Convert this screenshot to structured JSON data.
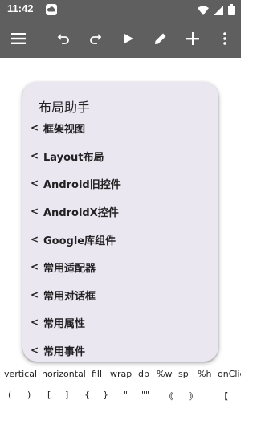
{
  "status_bar": {
    "time": "11:42",
    "icons": [
      "cloud-icon",
      "wifi-icon",
      "signal-icon",
      "battery-icon"
    ]
  },
  "toolbar": {
    "icons": [
      "menu-icon",
      "undo-icon",
      "redo-icon",
      "play-icon",
      "edit-icon",
      "add-icon",
      "more-vert-icon"
    ],
    "background": "#5f5f5f"
  },
  "card": {
    "title": "布局助手",
    "background": "#ebe7f1",
    "items": [
      {
        "chevron": "<",
        "label": "框架视图"
      },
      {
        "chevron": "<",
        "label": "Layout布局"
      },
      {
        "chevron": "<",
        "label": "Android旧控件"
      },
      {
        "chevron": "<",
        "label": "AndroidX控件"
      },
      {
        "chevron": "<",
        "label": "Google库组件"
      },
      {
        "chevron": "<",
        "label": "常用适配器"
      },
      {
        "chevron": "<",
        "label": "常用对话框"
      },
      {
        "chevron": "<",
        "label": "常用属性"
      },
      {
        "chevron": "<",
        "label": "常用事件"
      }
    ]
  },
  "keyword_bar": [
    "vertical",
    "horizontal",
    "fill",
    "wrap",
    "dp",
    "%w",
    "sp",
    "%h",
    "onClic"
  ],
  "symbol_bar": [
    "(",
    ")",
    "[",
    "]",
    "{",
    "}",
    "\"",
    "\"\"",
    "《",
    "》",
    "【"
  ]
}
